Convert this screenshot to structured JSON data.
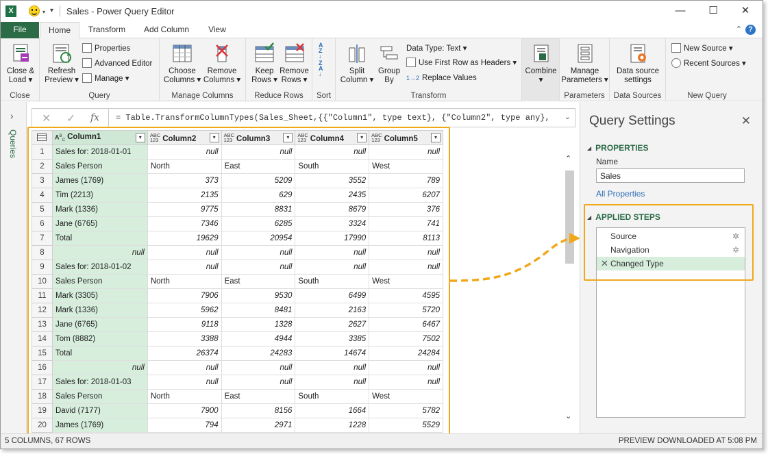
{
  "window": {
    "title": "Sales - Power Query Editor",
    "app_badge": "X",
    "qat_more": "▾",
    "controls": {
      "minimize": "—",
      "maximize": "☐",
      "close": "✕"
    }
  },
  "tabs": [
    "File",
    "Home",
    "Transform",
    "Add Column",
    "View"
  ],
  "ribbon": {
    "close_group": {
      "label": "Close",
      "button_line1": "Close &",
      "button_line2": "Load ▾"
    },
    "query_group": {
      "label": "Query",
      "refresh_line1": "Refresh",
      "refresh_line2": "Preview ▾",
      "properties": "Properties",
      "advanced_editor": "Advanced Editor",
      "manage": "Manage ▾"
    },
    "manage_columns_group": {
      "label": "Manage Columns",
      "choose_line1": "Choose",
      "choose_line2": "Columns ▾",
      "remove_line1": "Remove",
      "remove_line2": "Columns ▾"
    },
    "reduce_rows_group": {
      "label": "Reduce Rows",
      "keep_line1": "Keep",
      "keep_line2": "Rows ▾",
      "remove_line1": "Remove",
      "remove_line2": "Rows ▾"
    },
    "sort_group": {
      "label": "Sort"
    },
    "transform_group": {
      "label": "Transform",
      "split_line1": "Split",
      "split_line2": "Column ▾",
      "group_line1": "Group",
      "group_line2": "By",
      "data_type": "Data Type: Text ▾",
      "first_row_headers": "Use First Row as Headers ▾",
      "replace_values": "Replace Values"
    },
    "combine_group": {
      "label": "Combine",
      "combine_line2": "▾"
    },
    "parameters_group": {
      "label": "Parameters",
      "manage_line1": "Manage",
      "manage_line2": "Parameters ▾"
    },
    "data_sources_group": {
      "label": "Data Sources",
      "btn_line1": "Data source",
      "btn_line2": "settings"
    },
    "new_query_group": {
      "label": "New Query",
      "new_source": "New Source ▾",
      "recent_sources": "Recent Sources ▾"
    }
  },
  "left_rail": {
    "label": "Queries",
    "expand": "›"
  },
  "formula_bar": {
    "cancel": "✕",
    "commit": "✓",
    "fx": "fx",
    "formula": "= Table.TransformColumnTypes(Sales_Sheet,{{\"Column1\", type text}, {\"Column2\", type any},",
    "expand": "⌄"
  },
  "grid": {
    "columns": [
      {
        "name": "Column1",
        "type_top": "A",
        "type_bottom": "C",
        "type_mid": "B"
      },
      {
        "name": "Column2",
        "type_top": "ABC",
        "type_bottom": "123"
      },
      {
        "name": "Column3",
        "type_top": "ABC",
        "type_bottom": "123"
      },
      {
        "name": "Column4",
        "type_top": "ABC",
        "type_bottom": "123"
      },
      {
        "name": "Column5",
        "type_top": "ABC",
        "type_bottom": "123"
      }
    ],
    "rows": [
      [
        "1",
        "Sales for: 2018-01-01",
        "null",
        "null",
        "null",
        "null"
      ],
      [
        "2",
        "Sales Person",
        "North",
        "East",
        "South",
        "West"
      ],
      [
        "3",
        "James (1769)",
        "373",
        "5209",
        "3552",
        "789"
      ],
      [
        "4",
        "Tim (2213)",
        "2135",
        "629",
        "2435",
        "6207"
      ],
      [
        "5",
        "Mark (1336)",
        "9775",
        "8831",
        "8679",
        "376"
      ],
      [
        "6",
        "Jane (6765)",
        "7346",
        "6285",
        "3324",
        "741"
      ],
      [
        "7",
        "Total",
        "19629",
        "20954",
        "17990",
        "8113"
      ],
      [
        "8",
        "null",
        "null",
        "null",
        "null",
        "null"
      ],
      [
        "9",
        "Sales for: 2018-01-02",
        "null",
        "null",
        "null",
        "null"
      ],
      [
        "10",
        "Sales Person",
        "North",
        "East",
        "South",
        "West"
      ],
      [
        "11",
        "Mark (3305)",
        "7906",
        "9530",
        "6499",
        "4595"
      ],
      [
        "12",
        "Mark (1336)",
        "5962",
        "8481",
        "2163",
        "5720"
      ],
      [
        "13",
        "Jane (6765)",
        "9118",
        "1328",
        "2627",
        "6467"
      ],
      [
        "14",
        "Tom (8882)",
        "3388",
        "4944",
        "3385",
        "7502"
      ],
      [
        "15",
        "Total",
        "26374",
        "24283",
        "14674",
        "24284"
      ],
      [
        "16",
        "null",
        "null",
        "null",
        "null",
        "null"
      ],
      [
        "17",
        "Sales for: 2018-01-03",
        "null",
        "null",
        "null",
        "null"
      ],
      [
        "18",
        "Sales Person",
        "North",
        "East",
        "South",
        "West"
      ],
      [
        "19",
        "David (7177)",
        "7900",
        "8156",
        "1664",
        "5782"
      ],
      [
        "20",
        "James (1769)",
        "794",
        "2971",
        "1228",
        "5529"
      ]
    ]
  },
  "query_settings": {
    "title": "Query Settings",
    "close": "✕",
    "properties_header": "PROPERTIES",
    "name_label": "Name",
    "name_value": "Sales",
    "all_properties": "All Properties",
    "applied_steps_header": "APPLIED STEPS",
    "steps": [
      {
        "label": "Source",
        "has_gear": true,
        "selected": false
      },
      {
        "label": "Navigation",
        "has_gear": true,
        "selected": false
      },
      {
        "label": "Changed Type",
        "has_gear": false,
        "selected": true
      }
    ]
  },
  "status_bar": {
    "left": "5 COLUMNS, 67 ROWS",
    "right": "PREVIEW DOWNLOADED AT 5:08 PM"
  },
  "colors": {
    "accent_green": "#2b6b46",
    "selected_column": "#d7eedd",
    "highlight_orange": "#f0a81a"
  }
}
